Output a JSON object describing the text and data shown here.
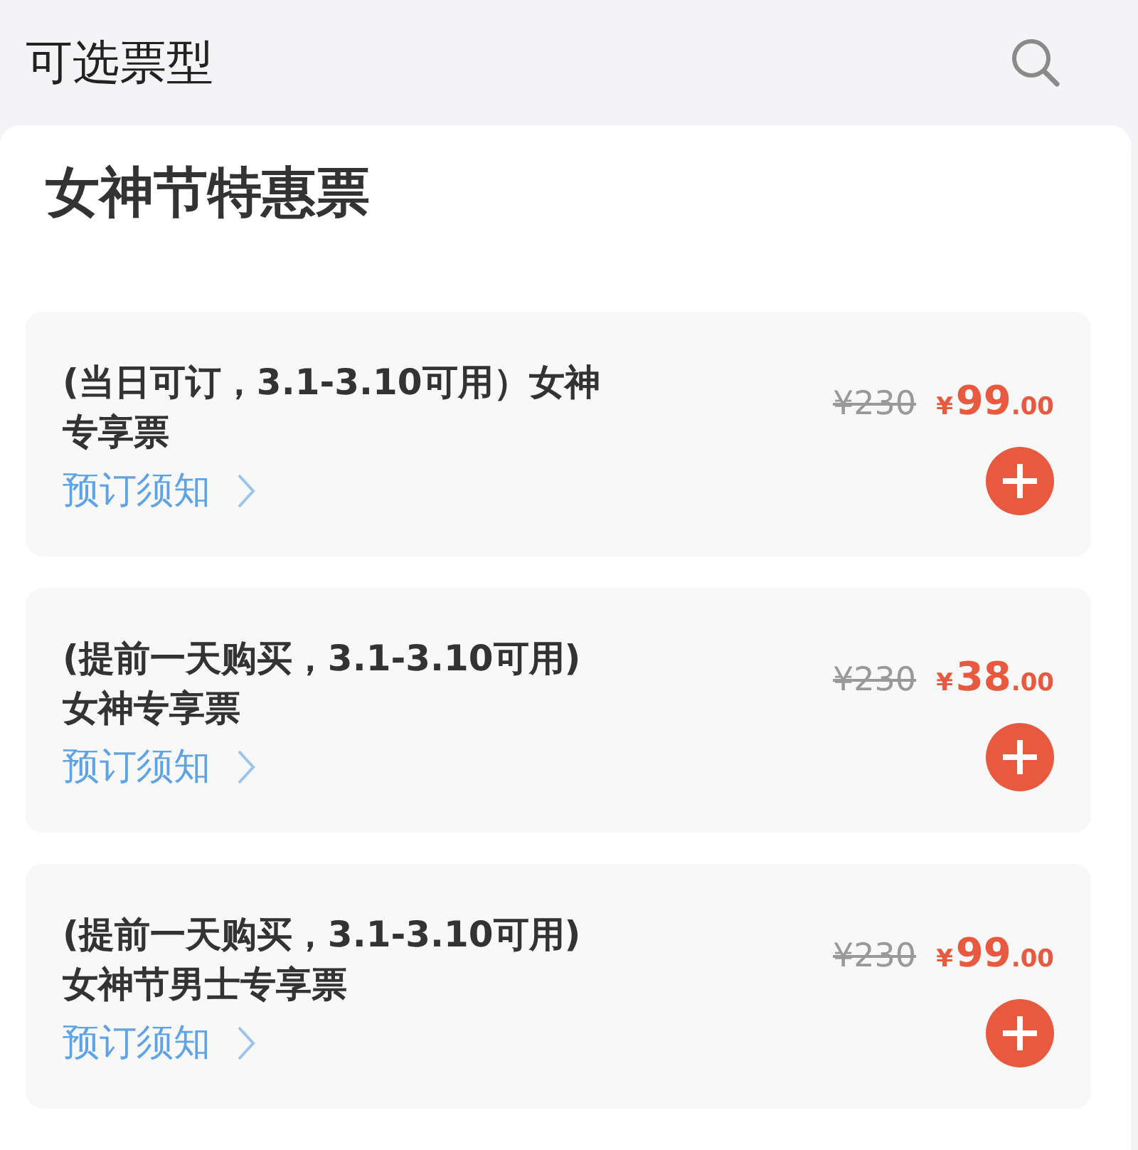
{
  "header": {
    "title": "可选票型"
  },
  "section": {
    "title": "女神节特惠票"
  },
  "tickets": [
    {
      "title_lines": [
        "(当日可订，3.1-3.10可用）女神",
        "专享票"
      ],
      "original_price": "¥230",
      "currency": "¥",
      "price_integer": "99",
      "price_decimal": ".00",
      "notice": "预订须知"
    },
    {
      "title_lines": [
        "(提前一天购买，3.1-3.10可用)",
        "女神专享票"
      ],
      "original_price": "¥230",
      "currency": "¥",
      "price_integer": "38",
      "price_decimal": ".00",
      "notice": "预订须知"
    },
    {
      "title_lines": [
        "(提前一天购买，3.1-3.10可用)",
        "女神节男士专享票"
      ],
      "original_price": "¥230",
      "currency": "¥",
      "price_integer": "99",
      "price_decimal": ".00",
      "notice": "预订须知"
    }
  ]
}
